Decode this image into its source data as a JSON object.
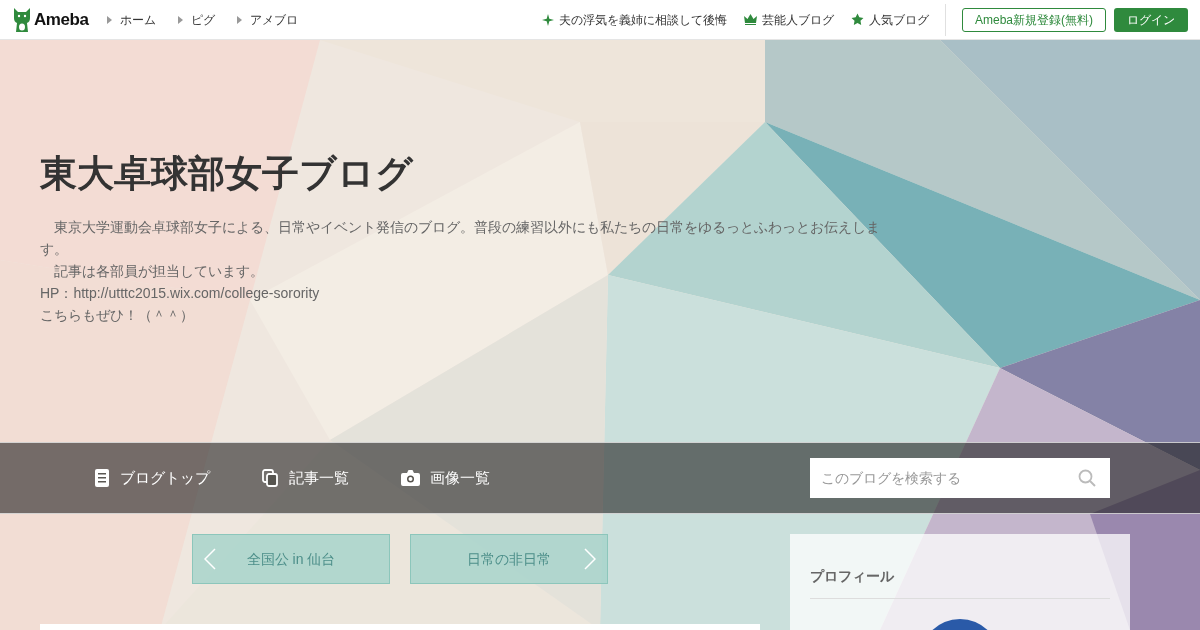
{
  "header": {
    "logo": "Ameba",
    "nav": [
      "ホーム",
      "ピグ",
      "アメブロ"
    ],
    "links": [
      {
        "kind": "sparkle",
        "label": "夫の浮気を義姉に相談して後悔"
      },
      {
        "kind": "crown",
        "label": "芸能人ブログ"
      },
      {
        "kind": "star",
        "label": "人気ブログ"
      }
    ],
    "register_button": "Ameba新規登録(無料)",
    "login_button": "ログイン"
  },
  "blog": {
    "title": "東大卓球部女子ブログ",
    "description": [
      "　東京大学運動会卓球部女子による、日常やイベント発信のブログ。普段の練習以外にも私たちの日常をゆるっとふわっとお伝えします。",
      "　記事は各部員が担当しています。",
      "HP：http://utttc2015.wix.com/college-sorority",
      "こちらもぜひ！（＾＾）"
    ]
  },
  "blog_nav": {
    "items": [
      {
        "kind": "document",
        "label": "ブログトップ"
      },
      {
        "kind": "copy",
        "label": "記事一覧"
      },
      {
        "kind": "camera",
        "label": "画像一覧"
      }
    ],
    "search": {
      "placeholder": "このブログを検索する"
    }
  },
  "pager": [
    {
      "kind": "prev",
      "label": "全国公 in 仙台"
    },
    {
      "kind": "next",
      "label": "日常の非日常"
    }
  ],
  "profile": {
    "heading": "プロフィール"
  }
}
